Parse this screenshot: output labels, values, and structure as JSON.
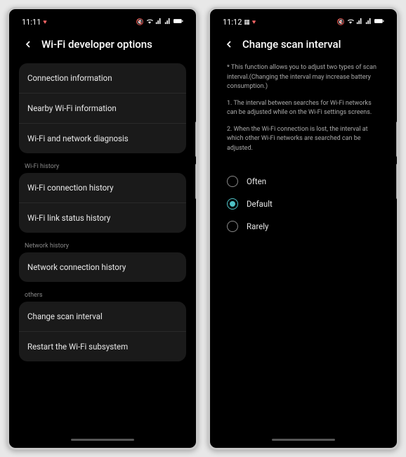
{
  "left": {
    "status": {
      "time": "11:11",
      "heart": "❤"
    },
    "header": {
      "title": "Wi-Fi developer options"
    },
    "groups": [
      {
        "items": [
          {
            "label": "Connection information"
          },
          {
            "label": "Nearby Wi-Fi information"
          },
          {
            "label": "Wi-Fi and network diagnosis"
          }
        ]
      },
      {
        "label": "Wi-Fi history",
        "items": [
          {
            "label": "Wi-Fi connection history"
          },
          {
            "label": "Wi-Fi link status history"
          }
        ]
      },
      {
        "label": "Network history",
        "items": [
          {
            "label": "Network connection history"
          }
        ]
      },
      {
        "label": "others",
        "items": [
          {
            "label": "Change scan interval"
          },
          {
            "label": "Restart the Wi-Fi subsystem"
          }
        ]
      }
    ]
  },
  "right": {
    "status": {
      "time": "11:12",
      "icons": "🖼 ❤"
    },
    "header": {
      "title": "Change scan interval"
    },
    "info": [
      "* This function allows you to adjust two types of scan interval.(Changing the interval may increase battery consumption.)",
      "1. The interval between searches for Wi-Fi networks can be adjusted while on the Wi-Fi settings screens.",
      "2. When the Wi-Fi connection is lost, the interval at which other Wi-Fi networks are searched can be adjusted."
    ],
    "options": [
      {
        "label": "Often",
        "selected": false
      },
      {
        "label": "Default",
        "selected": true
      },
      {
        "label": "Rarely",
        "selected": false
      }
    ]
  }
}
